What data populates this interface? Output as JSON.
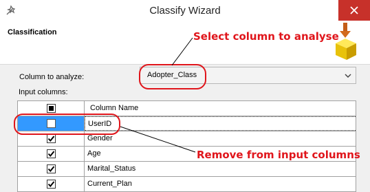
{
  "window": {
    "title": "Classify Wizard"
  },
  "header": {
    "title": "Classification"
  },
  "form": {
    "column_label": "Column to analyze:",
    "column_value": "Adopter_Class",
    "input_columns_label": "Input columns:"
  },
  "grid": {
    "header": {
      "column_name": "Column Name"
    },
    "rows": [
      {
        "name": "UserID",
        "checked": false
      },
      {
        "name": "Gender",
        "checked": true
      },
      {
        "name": "Age",
        "checked": true
      },
      {
        "name": "Marital_Status",
        "checked": true
      },
      {
        "name": "Current_Plan",
        "checked": true
      }
    ]
  },
  "annotations": {
    "select_column": "Select column to analyse",
    "remove_input": "Remove from input columns"
  },
  "colors": {
    "annotation": "#e0151b",
    "close": "#c7312a",
    "selection": "#3399ff"
  }
}
